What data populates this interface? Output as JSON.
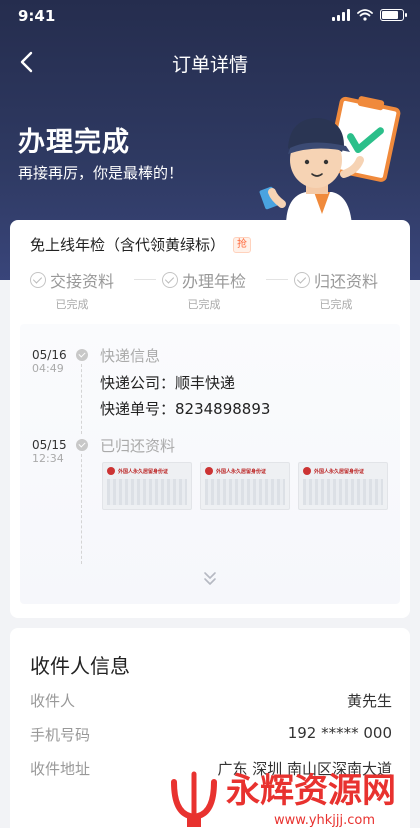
{
  "status_bar": {
    "time": "9:41"
  },
  "nav": {
    "title": "订单详情"
  },
  "hero": {
    "title": "办理完成",
    "subtitle": "再接再厉，你是最棒的！"
  },
  "order": {
    "service_name": "免上线年检（含代领黄绿标）",
    "badge": "抢",
    "steps": [
      {
        "label": "交接资料",
        "status": "已完成"
      },
      {
        "label": "办理年检",
        "status": "已完成"
      },
      {
        "label": "归还资料",
        "status": "已完成"
      }
    ],
    "timeline": [
      {
        "date": "05/16",
        "time": "04:49",
        "title": "快递信息",
        "lines": [
          "快递公司：顺丰快递",
          "快递单号：8234898893"
        ]
      },
      {
        "date": "05/15",
        "time": "12:34",
        "title": "已归还资料",
        "document_title": "外国人永久居留身份证"
      }
    ]
  },
  "recipient": {
    "title": "收件人信息",
    "rows": [
      {
        "label": "收件人",
        "value": "黄先生"
      },
      {
        "label": "手机号码",
        "value": "192 ***** 000"
      },
      {
        "label": "收件地址",
        "value": "广东 深圳 南山区深南大道"
      }
    ]
  },
  "watermark": {
    "brand": "永辉资源网",
    "url": "www.yhkjjj.com"
  },
  "colors": {
    "hero": "#2f3a63",
    "accent": "#ff6a3d",
    "watermark_red": "#e8322f"
  }
}
